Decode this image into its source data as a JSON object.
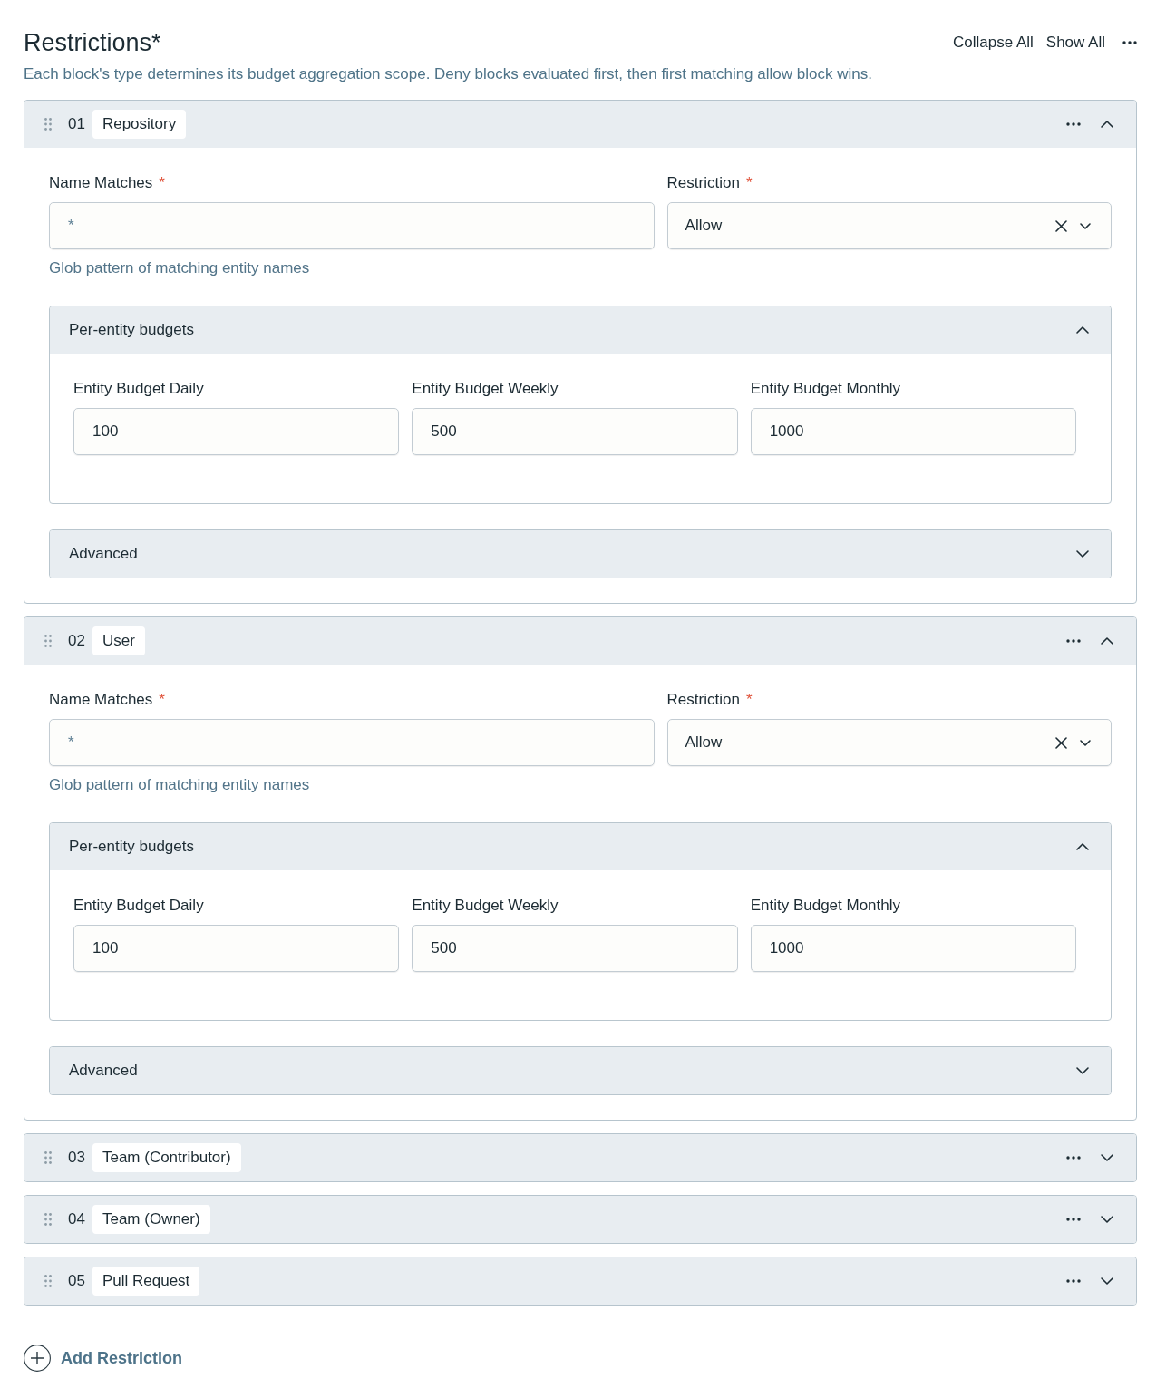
{
  "header": {
    "title": "Restrictions*",
    "description": "Each block's type determines its budget aggregation scope. Deny blocks evaluated first, then first matching allow block wins.",
    "actions": [
      {
        "label": "Collapse All"
      },
      {
        "label": "Show All"
      }
    ]
  },
  "restrictions": [
    {
      "number": "01",
      "type": "Repository",
      "expanded": true,
      "name_matches": {
        "label": "Name Matches",
        "required_mark": "*",
        "placeholder": "*",
        "hint": "Glob pattern of matching entity names"
      },
      "restriction": {
        "label": "Restriction",
        "required_mark": "*",
        "value": "Allow"
      },
      "sections": [
        {
          "title": "Per-entity budgets",
          "expanded": true,
          "fields": [
            {
              "label": "Entity Budget Daily",
              "value": "100"
            },
            {
              "label": "Entity Budget Weekly",
              "value": "500"
            },
            {
              "label": "Entity Budget Monthly",
              "value": "1000"
            }
          ]
        },
        {
          "title": "Advanced",
          "expanded": false
        }
      ]
    },
    {
      "number": "02",
      "type": "User",
      "expanded": true,
      "name_matches": {
        "label": "Name Matches",
        "required_mark": "*",
        "placeholder": "*",
        "hint": "Glob pattern of matching entity names"
      },
      "restriction": {
        "label": "Restriction",
        "required_mark": "*",
        "value": "Allow"
      },
      "sections": [
        {
          "title": "Per-entity budgets",
          "expanded": true,
          "fields": [
            {
              "label": "Entity Budget Daily",
              "value": "100"
            },
            {
              "label": "Entity Budget Weekly",
              "value": "500"
            },
            {
              "label": "Entity Budget Monthly",
              "value": "1000"
            }
          ]
        },
        {
          "title": "Advanced",
          "expanded": false
        }
      ]
    },
    {
      "number": "03",
      "type": "Team (Contributor)",
      "expanded": false
    },
    {
      "number": "04",
      "type": "Team (Owner)",
      "expanded": false
    },
    {
      "number": "05",
      "type": "Pull Request",
      "expanded": false
    }
  ],
  "add_button": {
    "label": "Add Restriction"
  }
}
